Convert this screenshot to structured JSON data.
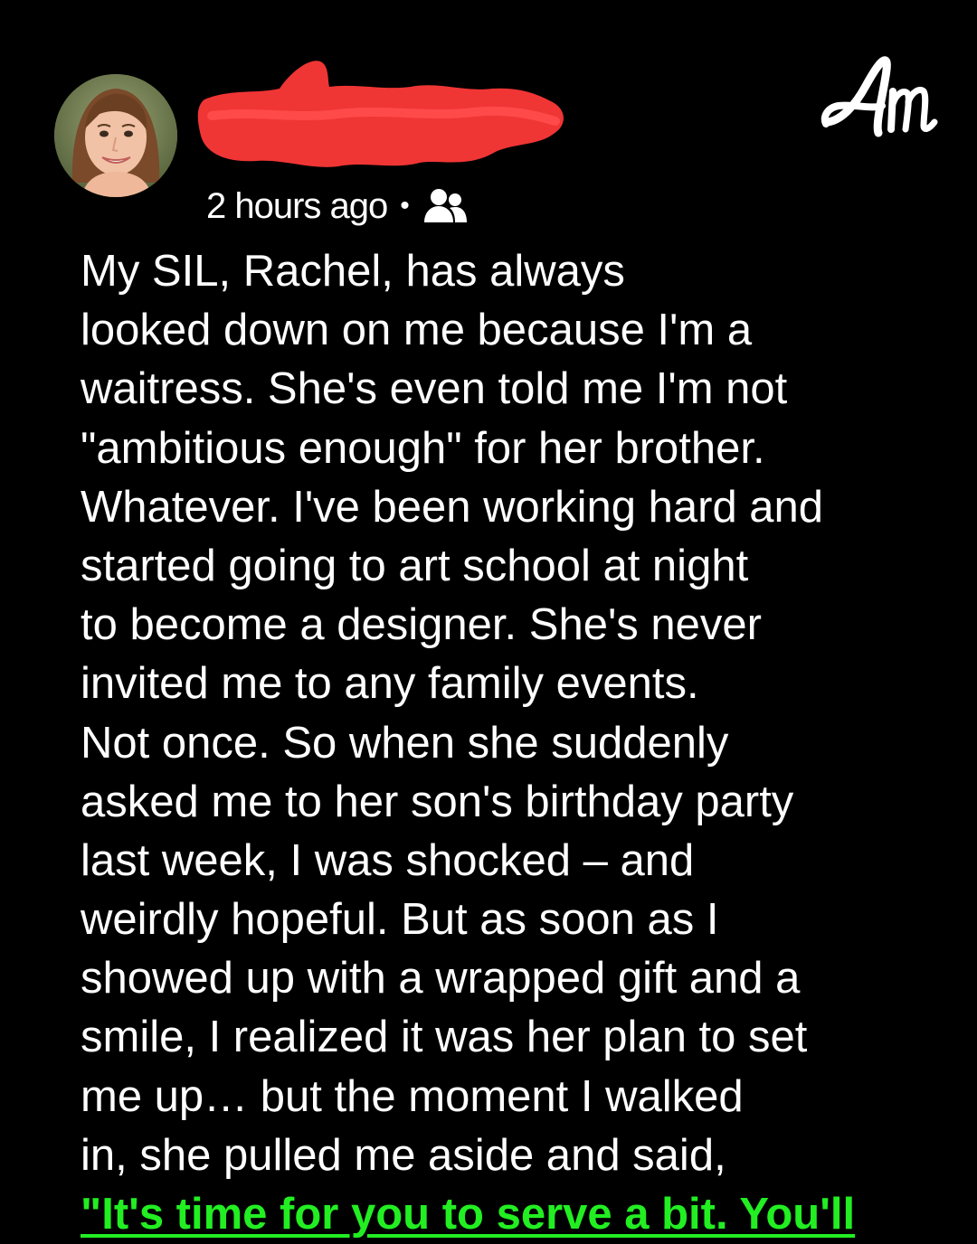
{
  "post": {
    "author": {
      "avatar_icon": "profile-photo",
      "name_redaction_color": "#f03535"
    },
    "brand": {
      "logo_text": "Am",
      "logo_icon": "amomama-logo"
    },
    "timestamp": "2 hours ago",
    "separator": "•",
    "audience_icon": "friends-icon",
    "lines": [
      "My SIL, Rachel, has always",
      "looked down on me because I'm a",
      "waitress. She's even told me I'm not",
      "\"ambitious enough\" for her brother.",
      "Whatever. I've been working hard and",
      "started going to art school at night",
      "to become a designer. She's never",
      "invited me to any family events.",
      "Not once. So when she suddenly",
      "asked me to her son's birthday party",
      "last week, I was shocked – and",
      "weirdly hopeful. But as soon as I",
      "showed up with a wrapped gift and a",
      "smile, I realized it was her plan to set",
      "me up… but the moment I walked",
      "in, she pulled me aside and said,"
    ],
    "quote_line": "\"It's time for you to serve a bit. You'll",
    "colors": {
      "background": "#000000",
      "text": "#ffffff",
      "quote": "#22ee22",
      "redaction": "#f03535"
    }
  }
}
